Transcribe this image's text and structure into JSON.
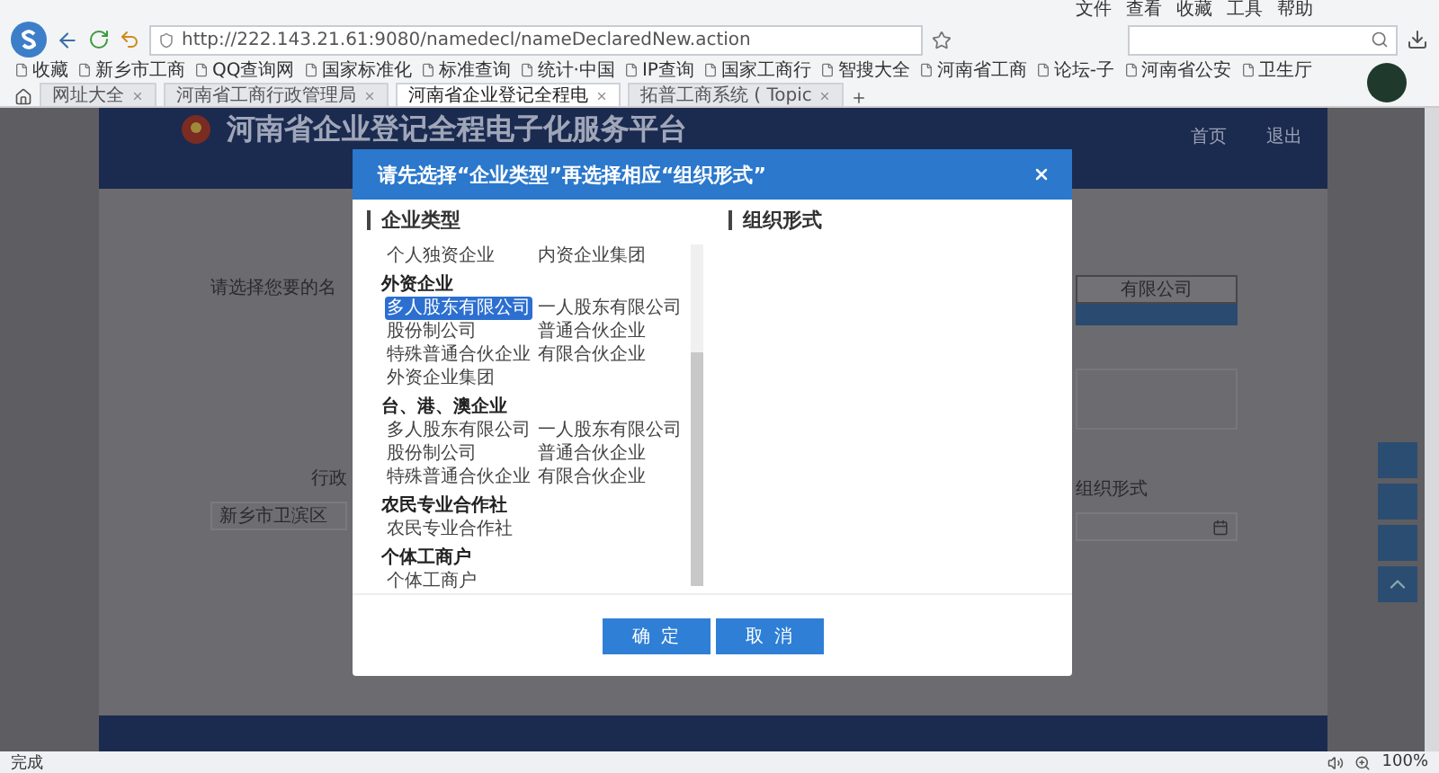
{
  "browser": {
    "menu": [
      "文件",
      "查看",
      "收藏",
      "工具",
      "帮助"
    ],
    "url": "http://222.143.21.61:9080/namedecl/nameDeclaredNew.action",
    "bookmarks": [
      "收藏",
      "新乡市工商",
      "QQ查询网",
      "国家标准化",
      "标准查询",
      "统计·中国",
      "IP查询",
      "国家工商行",
      "智搜大全",
      "河南省工商",
      "论坛-子",
      "河南省公安",
      "卫生厅"
    ],
    "tabs": [
      {
        "label": "网址大全",
        "selected": false
      },
      {
        "label": "河南省工商行政管理局",
        "selected": false
      },
      {
        "label": "河南省企业登记全程电",
        "selected": true
      },
      {
        "label": "拓普工商系统 ( Topic",
        "selected": false
      }
    ],
    "status": "完成",
    "zoom": "100%"
  },
  "site": {
    "title": "河南省企业登记全程电子化服务平台",
    "nav": [
      "首页",
      "退出"
    ],
    "prompt": "请选择您要的名",
    "region_label": "行政",
    "region_value": "新乡市卫滨区",
    "company_type": "有限公司",
    "org_form_label": "组织形式"
  },
  "dialog": {
    "title": "请先选择“企业类型”再选择相应“组织形式”",
    "left_heading": "企业类型",
    "right_heading": "组织形式",
    "groups": [
      {
        "items": [
          {
            "label": "个人独资企业",
            "selected": false
          },
          {
            "label": "内资企业集团",
            "selected": false
          }
        ]
      },
      {
        "name": "外资企业",
        "items": [
          {
            "label": "多人股东有限公司",
            "selected": true
          },
          {
            "label": "一人股东有限公司",
            "selected": false
          },
          {
            "label": "股份制公司",
            "selected": false
          },
          {
            "label": "普通合伙企业",
            "selected": false
          },
          {
            "label": "特殊普通合伙企业",
            "selected": false
          },
          {
            "label": "有限合伙企业",
            "selected": false
          },
          {
            "label": "外资企业集团",
            "selected": false
          }
        ]
      },
      {
        "name": "台、港、澳企业",
        "items": [
          {
            "label": "多人股东有限公司",
            "selected": false
          },
          {
            "label": "一人股东有限公司",
            "selected": false
          },
          {
            "label": "股份制公司",
            "selected": false
          },
          {
            "label": "普通合伙企业",
            "selected": false
          },
          {
            "label": "特殊普通合伙企业",
            "selected": false
          },
          {
            "label": "有限合伙企业",
            "selected": false
          }
        ]
      },
      {
        "name": "农民专业合作社",
        "items": [
          {
            "label": "农民专业合作社",
            "selected": false
          }
        ]
      },
      {
        "name": "个体工商户",
        "items": [
          {
            "label": "个体工商户",
            "selected": false
          }
        ]
      }
    ],
    "buttons": [
      "确定",
      "取消"
    ]
  }
}
